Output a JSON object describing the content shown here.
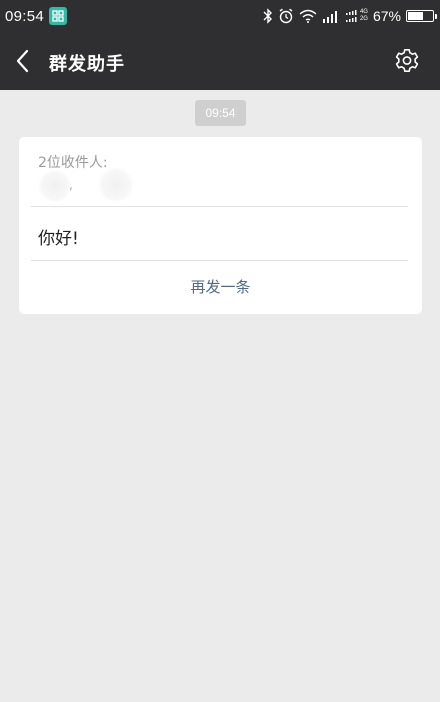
{
  "status_bar": {
    "time": "09:54",
    "network_type_top": "4G",
    "network_type_bottom": "2G",
    "battery_percent": "67%",
    "battery_level": 0.67,
    "icons": [
      "app-icon",
      "bluetooth-icon",
      "alarm-icon",
      "wifi-icon",
      "signal-icon",
      "dual-signal-icon",
      "battery-icon"
    ]
  },
  "header": {
    "title": "群发助手",
    "back_icon": "chevron-left-icon",
    "settings_icon": "gear-icon"
  },
  "chat": {
    "timestamp": "09:54",
    "card": {
      "recipients_label": "2位收件人:",
      "recipients_separator": ", ",
      "message": "你好!",
      "resend_label": "再发一条"
    }
  },
  "colors": {
    "bar_bg": "#2f2f31",
    "page_bg": "#ebebeb",
    "link": "#4f6a8f",
    "app_icon": "#33b8a6"
  }
}
